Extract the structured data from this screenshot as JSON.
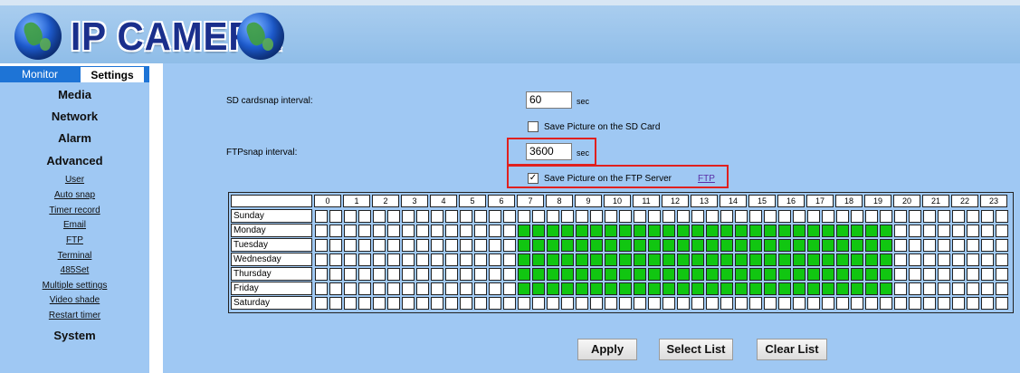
{
  "header": {
    "title": "IP CAMERA"
  },
  "tabs": {
    "monitor": "Monitor",
    "settings": "Settings"
  },
  "sidebar": {
    "sections": {
      "media": "Media",
      "network": "Network",
      "alarm": "Alarm",
      "advanced": "Advanced",
      "system": "System"
    },
    "advanced_items": [
      "User",
      "Auto snap",
      "Timer record",
      "Email",
      "FTP",
      "Terminal",
      "485Set",
      "Multiple settings",
      "Video shade",
      "Restart timer"
    ]
  },
  "form": {
    "sd_label": "SD cardsnap interval:",
    "sd_value": "60",
    "sd_unit": "sec",
    "sd_save_label": "Save Picture on the SD Card",
    "sd_save_checked": false,
    "ftp_label": "FTPsnap interval:",
    "ftp_value": "3600",
    "ftp_unit": "sec",
    "ftp_save_label": "Save Picture on the FTP Server",
    "ftp_save_checked": true,
    "ftp_link": "FTP"
  },
  "schedule": {
    "hours": [
      "0",
      "1",
      "2",
      "3",
      "4",
      "5",
      "6",
      "7",
      "8",
      "9",
      "10",
      "11",
      "12",
      "13",
      "14",
      "15",
      "16",
      "17",
      "18",
      "19",
      "20",
      "21",
      "22",
      "23"
    ],
    "days": [
      {
        "name": "Sunday",
        "on": [
          0,
          0,
          0,
          0,
          0,
          0,
          0,
          0,
          0,
          0,
          0,
          0,
          0,
          0,
          0,
          0,
          0,
          0,
          0,
          0,
          0,
          0,
          0,
          0,
          0,
          0,
          0,
          0,
          0,
          0,
          0,
          0,
          0,
          0,
          0,
          0,
          0,
          0,
          0,
          0,
          0,
          0,
          0,
          0,
          0,
          0,
          0,
          0
        ]
      },
      {
        "name": "Monday",
        "on": [
          0,
          0,
          0,
          0,
          0,
          0,
          0,
          0,
          0,
          0,
          0,
          0,
          0,
          0,
          1,
          1,
          1,
          1,
          1,
          1,
          1,
          1,
          1,
          1,
          1,
          1,
          1,
          1,
          1,
          1,
          1,
          1,
          1,
          1,
          1,
          1,
          1,
          1,
          1,
          1,
          0,
          0,
          0,
          0,
          0,
          0,
          0,
          0
        ]
      },
      {
        "name": "Tuesday",
        "on": [
          0,
          0,
          0,
          0,
          0,
          0,
          0,
          0,
          0,
          0,
          0,
          0,
          0,
          0,
          1,
          1,
          1,
          1,
          1,
          1,
          1,
          1,
          1,
          1,
          1,
          1,
          1,
          1,
          1,
          1,
          1,
          1,
          1,
          1,
          1,
          1,
          1,
          1,
          1,
          1,
          0,
          0,
          0,
          0,
          0,
          0,
          0,
          0
        ]
      },
      {
        "name": "Wednesday",
        "on": [
          0,
          0,
          0,
          0,
          0,
          0,
          0,
          0,
          0,
          0,
          0,
          0,
          0,
          0,
          1,
          1,
          1,
          1,
          1,
          1,
          1,
          1,
          1,
          1,
          1,
          1,
          1,
          1,
          1,
          1,
          1,
          1,
          1,
          1,
          1,
          1,
          1,
          1,
          1,
          1,
          0,
          0,
          0,
          0,
          0,
          0,
          0,
          0
        ]
      },
      {
        "name": "Thursday",
        "on": [
          0,
          0,
          0,
          0,
          0,
          0,
          0,
          0,
          0,
          0,
          0,
          0,
          0,
          0,
          1,
          1,
          1,
          1,
          1,
          1,
          1,
          1,
          1,
          1,
          1,
          1,
          1,
          1,
          1,
          1,
          1,
          1,
          1,
          1,
          1,
          1,
          1,
          1,
          1,
          1,
          0,
          0,
          0,
          0,
          0,
          0,
          0,
          0
        ]
      },
      {
        "name": "Friday",
        "on": [
          0,
          0,
          0,
          0,
          0,
          0,
          0,
          0,
          0,
          0,
          0,
          0,
          0,
          0,
          1,
          1,
          1,
          1,
          1,
          1,
          1,
          1,
          1,
          1,
          1,
          1,
          1,
          1,
          1,
          1,
          1,
          1,
          1,
          1,
          1,
          1,
          1,
          1,
          1,
          1,
          0,
          0,
          0,
          0,
          0,
          0,
          0,
          0
        ]
      },
      {
        "name": "Saturday",
        "on": [
          0,
          0,
          0,
          0,
          0,
          0,
          0,
          0,
          0,
          0,
          0,
          0,
          0,
          0,
          0,
          0,
          0,
          0,
          0,
          0,
          0,
          0,
          0,
          0,
          0,
          0,
          0,
          0,
          0,
          0,
          0,
          0,
          0,
          0,
          0,
          0,
          0,
          0,
          0,
          0,
          0,
          0,
          0,
          0,
          0,
          0,
          0,
          0
        ]
      }
    ]
  },
  "buttons": {
    "apply": "Apply",
    "select_list": "Select List",
    "clear_list": "Clear List"
  },
  "colors": {
    "panel": "#9fc8f3",
    "tab_blue": "#1e74d6",
    "active_cell": "#11c611",
    "highlight": "#e0201e"
  }
}
